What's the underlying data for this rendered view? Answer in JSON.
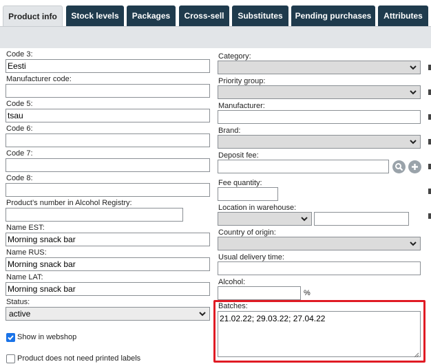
{
  "tabs": [
    {
      "label": "Product info",
      "active": true
    },
    {
      "label": "Stock levels",
      "active": false
    },
    {
      "label": "Packages",
      "active": false
    },
    {
      "label": "Cross-sell",
      "active": false
    },
    {
      "label": "Substitutes",
      "active": false
    },
    {
      "label": "Pending purchases",
      "active": false
    },
    {
      "label": "Attributes",
      "active": false
    }
  ],
  "left": {
    "code3": {
      "label": "Code 3:",
      "value": "Eesti"
    },
    "manufacturer_code": {
      "label": "Manufacturer code:",
      "value": ""
    },
    "code5": {
      "label": "Code 5:",
      "value": "tsau"
    },
    "code6": {
      "label": "Code 6:",
      "value": ""
    },
    "code7": {
      "label": "Code 7:",
      "value": ""
    },
    "code8": {
      "label": "Code 8:",
      "value": ""
    },
    "alcohol_registry": {
      "label": "Product’s number in Alcohol Registry:",
      "value": ""
    },
    "name_est": {
      "label": "Name EST:",
      "value": "Morning snack bar"
    },
    "name_rus": {
      "label": "Name RUS:",
      "value": "Morning snack bar"
    },
    "name_lat": {
      "label": "Name LAT:",
      "value": "Morning snack bar"
    },
    "status": {
      "label": "Status:",
      "value": "active"
    },
    "show_in_webshop": {
      "label": "Show in webshop",
      "checked": true
    },
    "no_printed_labels": {
      "label": "Product does not need printed labels",
      "checked": false
    }
  },
  "right": {
    "category": {
      "label": "Category:",
      "value": ""
    },
    "priority_group": {
      "label": "Priority group:",
      "value": ""
    },
    "manufacturer": {
      "label": "Manufacturer:",
      "value": ""
    },
    "brand": {
      "label": "Brand:",
      "value": ""
    },
    "deposit_fee": {
      "label": "Deposit fee:",
      "value": ""
    },
    "fee_quantity": {
      "label": "Fee quantity:",
      "value": ""
    },
    "location": {
      "label": "Location in warehouse:",
      "value": "",
      "text_value": ""
    },
    "country_of_origin": {
      "label": "Country of origin:",
      "value": ""
    },
    "usual_delivery_time": {
      "label": "Usual delivery time:",
      "value": ""
    },
    "alcohol": {
      "label": "Alcohol:",
      "value": "",
      "unit": "%"
    },
    "batches": {
      "label": "Batches:",
      "value": "21.02.22; 29.03.22; 27.04.22"
    }
  },
  "icons": {
    "search": "magnifier-icon",
    "add": "plus-icon",
    "dropdown": "chevron-down-icon"
  },
  "colors": {
    "tab_bg": "#1f3b4d",
    "active_tab_bg": "#e2e5e8",
    "highlight": "#e01b24",
    "checkbox": "#1a73e8"
  }
}
